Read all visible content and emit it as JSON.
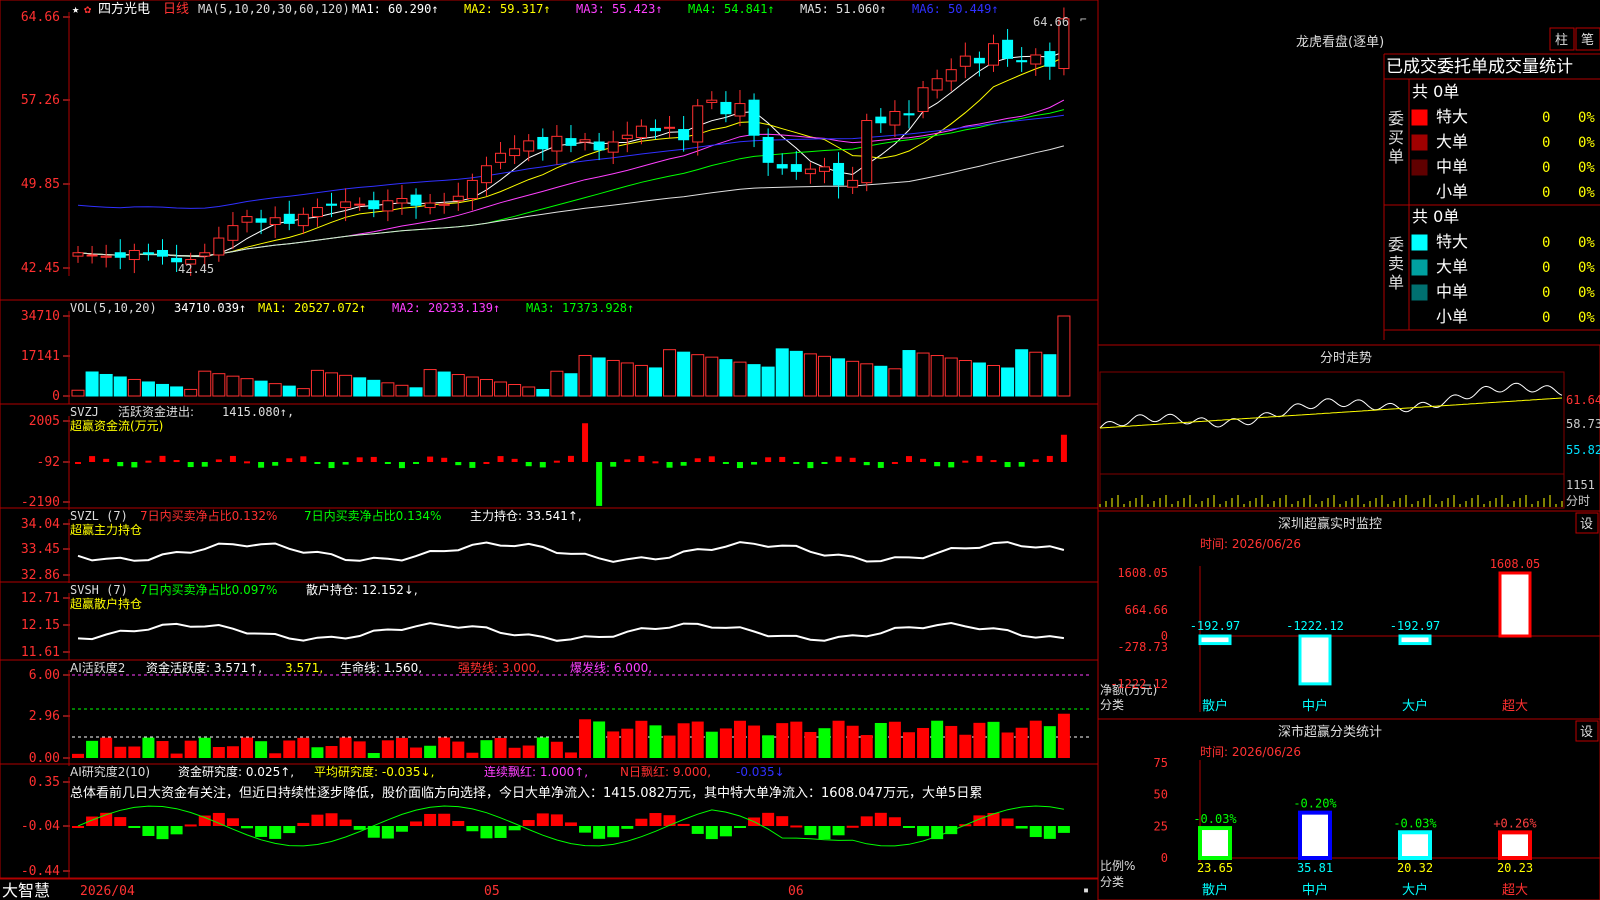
{
  "kline": {
    "stock_name": "四方光电",
    "period": "日线",
    "ma_label": "MA(5,10,20,30,60,120)",
    "ma_items": [
      {
        "label": "MA1:",
        "value": "60.290↑",
        "color": "#ffffff"
      },
      {
        "label": "MA2:",
        "value": "59.317↑",
        "color": "#ffff00"
      },
      {
        "label": "MA3:",
        "value": "55.423↑",
        "color": "#ff40ff"
      },
      {
        "label": "MA4:",
        "value": "54.841↑",
        "color": "#00ff00"
      },
      {
        "label": "MA5:",
        "value": "51.060↑",
        "color": "#e0e0e0"
      },
      {
        "label": "MA6:",
        "value": "50.449↑",
        "color": "#3030ff"
      }
    ],
    "y_ticks": [
      "64.66",
      "57.26",
      "49.85",
      "42.45"
    ],
    "y_tick_values": [
      64.66,
      57.26,
      49.85,
      42.45
    ],
    "high_label": "64.66",
    "low_label": "42.45",
    "date_start": "2026/04",
    "month_labels": [
      "05",
      "06"
    ]
  },
  "vol": {
    "label": "VOL(5,10,20)",
    "value": "34710.039↑",
    "ma_items": [
      {
        "label": "MA1:",
        "value": "20527.072↑",
        "color": "#ffff00"
      },
      {
        "label": "MA2:",
        "value": "20233.139↑",
        "color": "#ff40ff"
      },
      {
        "label": "MA3:",
        "value": "17373.928↑",
        "color": "#00ff00"
      }
    ],
    "y_ticks": [
      "34710",
      "17141",
      "0"
    ]
  },
  "svzj": {
    "label": "SVZJ",
    "title": "活跃资金进出:",
    "value": "1415.080↑,",
    "subtitle": "超赢资金流(万元)",
    "y_ticks": [
      "2005",
      "-92",
      "-2190"
    ]
  },
  "svzl": {
    "label": "SVZL (7)",
    "t1": "7日内买卖净占比0.132%",
    "t2": "7日内买卖净占比0.134%",
    "t3": "主力持仓: 33.541↑,",
    "subtitle": "超赢主力持仓",
    "y_ticks": [
      "34.04",
      "33.45",
      "32.86"
    ]
  },
  "svsh": {
    "label": "SVSH (7)",
    "t1": "7日内买卖净占比0.097%",
    "t2": "散户持仓: 12.152↓,",
    "subtitle": "超赢散户持仓",
    "y_ticks": [
      "12.71",
      "12.15",
      "11.61"
    ]
  },
  "ai1": {
    "label": "AI活跃度2",
    "t1": "资金活跃度: 3.571↑,",
    "t2": "3.571,",
    "t3": "生命线: 1.560,",
    "t4": "强势线: 3.000,",
    "t5": "爆发线: 6.000,",
    "y_ticks": [
      "6.00",
      "2.96",
      "0.00"
    ]
  },
  "ai2": {
    "label": "AI研究度2(10)",
    "t1": "资金研究度: 0.025↑,",
    "t2": "平均研究度: -0.035↓,",
    "t3": "连续飘红: 1.000↑,",
    "t4": "N日飘红: 9.000,",
    "t5": "-0.035↓",
    "comment": "总体看前几日大资金有关注，但近日持续性逐步降低，股价面临方向选择，今日大单净流入：1415.082万元，其中特大单净流入：1608.047万元，大单5日累",
    "y_ticks": [
      "0.35",
      "-0.04",
      "-0.44"
    ]
  },
  "footer": {
    "brand": "大智慧"
  },
  "panel": {
    "dragon_title": "龙虎看盘(逐单)",
    "btn_zhu": "柱",
    "btn_bi": "笔",
    "stats_title": "已成交委托单成交量统计",
    "buy_side": "委买单",
    "sell_side": "委卖单",
    "buy_total": "共 0单",
    "sell_total": "共 0单",
    "buy_rows": [
      {
        "name": "特大",
        "count": "0",
        "pct": "0%",
        "color": "#ff0000"
      },
      {
        "name": "大单",
        "count": "0",
        "pct": "0%",
        "color": "#a00000"
      },
      {
        "name": "中单",
        "count": "0",
        "pct": "0%",
        "color": "#600000"
      },
      {
        "name": "小单",
        "count": "0",
        "pct": "0%",
        "color": "#000000"
      }
    ],
    "sell_rows": [
      {
        "name": "特大",
        "count": "0",
        "pct": "0%",
        "color": "#00ffff"
      },
      {
        "name": "大单",
        "count": "0",
        "pct": "0%",
        "color": "#00a0a0"
      },
      {
        "name": "中单",
        "count": "0",
        "pct": "0%",
        "color": "#007070"
      },
      {
        "name": "小单",
        "count": "0",
        "pct": "0%",
        "color": "#000000"
      }
    ],
    "intraday_title": "分时走势",
    "intraday_ticks": [
      "61.64",
      "58.73",
      "55.82"
    ],
    "intraday_vol": "1151",
    "intraday_vol_unit": "分时",
    "monitor_title": "深圳超赢实时监控",
    "monitor_btn": "设",
    "monitor_time": "时间: 2026/06/26",
    "monitor_ticks": [
      "1608.05",
      "664.66",
      "0",
      "-278.73",
      "-1222.12"
    ],
    "monitor_ylabel": "净额(万元)",
    "monitor_xlabel": "分类",
    "category_stats_title": "深市超赢分类统计",
    "category_btn": "设",
    "category_time": "时间: 2026/06/26",
    "category_ticks": [
      "75",
      "50",
      "25",
      "0"
    ],
    "category_ylabel": "比例%",
    "category_xlabel": "分类"
  },
  "chart_data": [
    {
      "type": "bar",
      "title": "深圳超赢实时监控",
      "ylabel": "净额(万元)",
      "xlabel": "分类",
      "categories": [
        "散户",
        "中户",
        "大户",
        "超大"
      ],
      "values": [
        -192.97,
        -1222.12,
        -192.97,
        1608.05
      ],
      "value_labels": [
        "-192.97",
        "-1222.12",
        "-192.97",
        "1608.05"
      ],
      "ylim": [
        -1222.12,
        1608.05
      ],
      "colors": [
        "#00ffff",
        "#00ffff",
        "#00ffff",
        "#ff0000"
      ]
    },
    {
      "type": "bar",
      "title": "深市超赢分类统计",
      "ylabel": "比例%",
      "xlabel": "分类",
      "categories": [
        "散户",
        "中户",
        "大户",
        "超大"
      ],
      "values": [
        23.65,
        35.81,
        20.32,
        20.23
      ],
      "value_labels": [
        "23.65",
        "35.81",
        "20.32",
        "20.23"
      ],
      "change_labels": [
        "-0.03%",
        "-0.20%",
        "-0.03%",
        "+0.26%"
      ],
      "change_colors": [
        "#00ff00",
        "#00ff00",
        "#00ff00",
        "#ff4040"
      ],
      "ylim": [
        0,
        75
      ],
      "colors": [
        "#00ff00",
        "#0000ff",
        "#00ffff",
        "#ff0000"
      ]
    }
  ]
}
